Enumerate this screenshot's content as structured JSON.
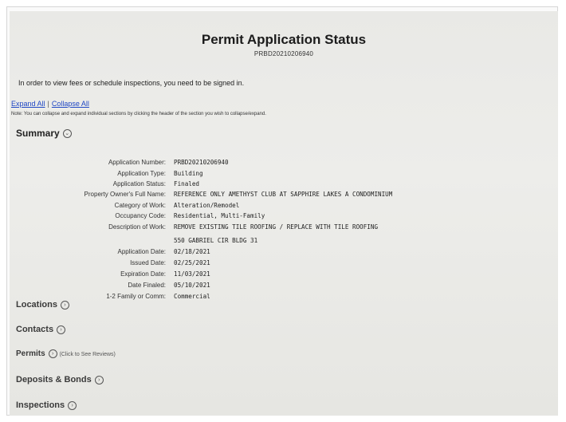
{
  "page": {
    "title": "Permit Application Status",
    "permit_number": "PRBD20210206940",
    "signin_note": "In order to view fees or schedule inspections, you need to be signed in.",
    "expand_all": "Expand All",
    "collapse_all": "Collapse All",
    "collapse_note": "Note: You can collapse and expand individual sections by clicking the header of the section you wish to collapse/expand."
  },
  "summary": {
    "header": "Summary",
    "fields": [
      {
        "label": "Application Number:",
        "value": "PRBD20210206940"
      },
      {
        "label": "Application Type:",
        "value": "Building"
      },
      {
        "label": "Application Status:",
        "value": "Finaled"
      },
      {
        "label": "Property Owner's Full Name:",
        "value": "REFERENCE ONLY AMETHYST CLUB AT SAPPHIRE LAKES A CONDOMINIUM"
      },
      {
        "label": "Category of Work:",
        "value": "Alteration/Remodel"
      },
      {
        "label": "Occupancy Code:",
        "value": "Residential, Multi-Family"
      },
      {
        "label": "Description of Work:",
        "value": "REMOVE EXISTING TILE ROOFING / REPLACE WITH TILE ROOFING"
      },
      {
        "label": "",
        "value": "550 GABRIEL CIR BLDG 31"
      },
      {
        "label": "Application Date:",
        "value": "02/18/2021"
      },
      {
        "label": "Issued Date:",
        "value": "02/25/2021"
      },
      {
        "label": "Expiration Date:",
        "value": "11/03/2021"
      },
      {
        "label": "Date Finaled:",
        "value": "05/10/2021"
      },
      {
        "label": "1-2 Family or Comm:",
        "value": "Commercial"
      }
    ]
  },
  "sections": {
    "locations": "Locations",
    "contacts": "Contacts",
    "permits": "Permits",
    "permits_subnote": "(Click to See Reviews)",
    "deposits": "Deposits & Bonds",
    "inspections": "Inspections"
  }
}
